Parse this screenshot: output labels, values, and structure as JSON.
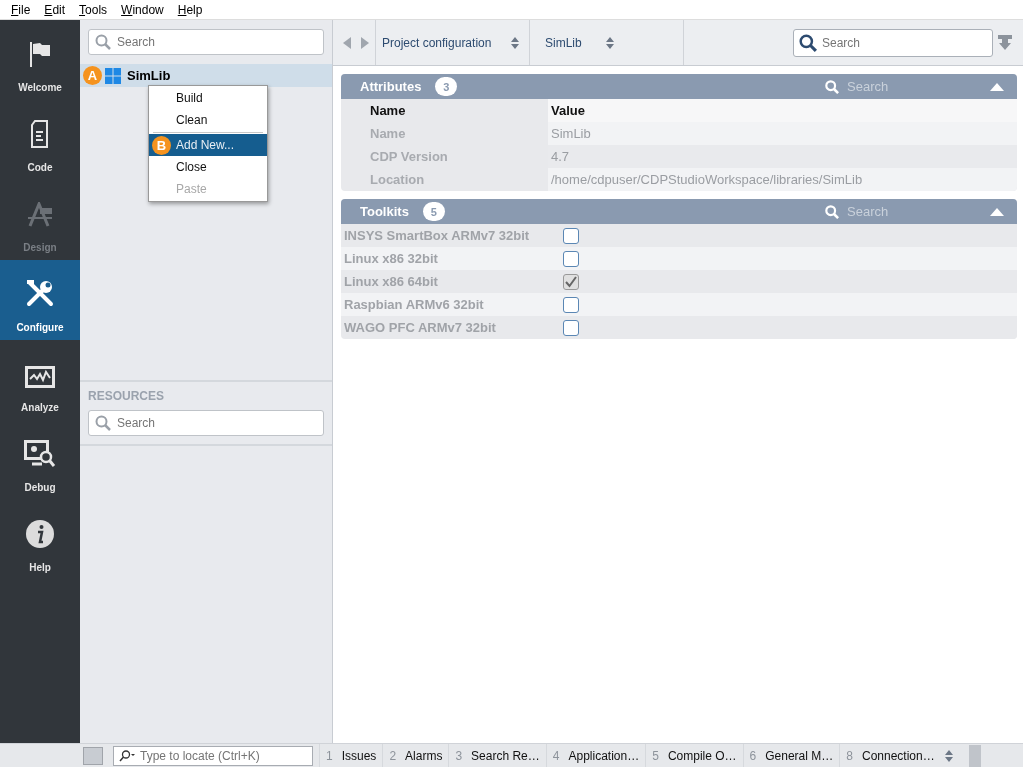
{
  "menu_bar": [
    {
      "label": "File"
    },
    {
      "label": "Edit"
    },
    {
      "label": "Tools"
    },
    {
      "label": "Window"
    },
    {
      "label": "Help"
    }
  ],
  "sidebar": {
    "items": [
      {
        "label": "Welcome",
        "selected": false,
        "disabled": false
      },
      {
        "label": "Code",
        "selected": false,
        "disabled": false
      },
      {
        "label": "Design",
        "selected": false,
        "disabled": true
      },
      {
        "label": "Configure",
        "selected": true,
        "disabled": false
      },
      {
        "label": "Analyze",
        "selected": false,
        "disabled": false
      },
      {
        "label": "Debug",
        "selected": false,
        "disabled": false
      },
      {
        "label": "Help",
        "selected": false,
        "disabled": false
      }
    ]
  },
  "project_tree": {
    "search": {
      "placeholder": "Search"
    },
    "items": [
      {
        "label": "SimLib",
        "marker": "A",
        "selected": true
      }
    ]
  },
  "context_menu": {
    "items": [
      {
        "label": "Build",
        "disabled": false,
        "selected": false
      },
      {
        "label": "Clean",
        "disabled": false,
        "selected": false,
        "separator_after": true
      },
      {
        "label": "Add New...",
        "disabled": false,
        "selected": true,
        "marker": "B"
      },
      {
        "label": "Close",
        "disabled": false,
        "selected": false
      },
      {
        "label": "Paste",
        "disabled": true,
        "selected": false
      }
    ]
  },
  "resources": {
    "title": "RESOURCES",
    "search": {
      "placeholder": "Search"
    }
  },
  "toolbar": {
    "combos": [
      {
        "value": "Project configuration"
      },
      {
        "value": "SimLib"
      }
    ],
    "search": {
      "placeholder": "Search"
    }
  },
  "attributes": {
    "title": "Attributes",
    "count": "3",
    "search": {
      "placeholder": "Search"
    },
    "columns": [
      "Name",
      "Value"
    ],
    "rows": [
      {
        "name": "Name",
        "value": "SimLib"
      },
      {
        "name": "CDP Version",
        "value": "4.7"
      },
      {
        "name": "Location",
        "value": "/home/cdpuser/CDPStudioWorkspace/libraries/SimLib"
      }
    ]
  },
  "toolkits": {
    "title": "Toolkits",
    "count": "5",
    "search": {
      "placeholder": "Search"
    },
    "rows": [
      {
        "name": "INSYS SmartBox ARMv7 32bit",
        "checked": false,
        "disabled": false
      },
      {
        "name": "Linux x86 32bit",
        "checked": false,
        "disabled": false
      },
      {
        "name": "Linux x86 64bit",
        "checked": true,
        "disabled": true
      },
      {
        "name": "Raspbian ARMv6 32bit",
        "checked": false,
        "disabled": false
      },
      {
        "name": "WAGO PFC ARMv7 32bit",
        "checked": false,
        "disabled": false
      }
    ]
  },
  "status_bar": {
    "locate": {
      "placeholder": "Type to locate (Ctrl+K)"
    },
    "tabs": [
      {
        "number": "1",
        "label": "Issues"
      },
      {
        "number": "2",
        "label": "Alarms"
      },
      {
        "number": "3",
        "label": "Search Re…"
      },
      {
        "number": "4",
        "label": "Application…"
      },
      {
        "number": "5",
        "label": "Compile O…"
      },
      {
        "number": "6",
        "label": "General M…"
      },
      {
        "number": "8",
        "label": "Connection…"
      }
    ]
  }
}
